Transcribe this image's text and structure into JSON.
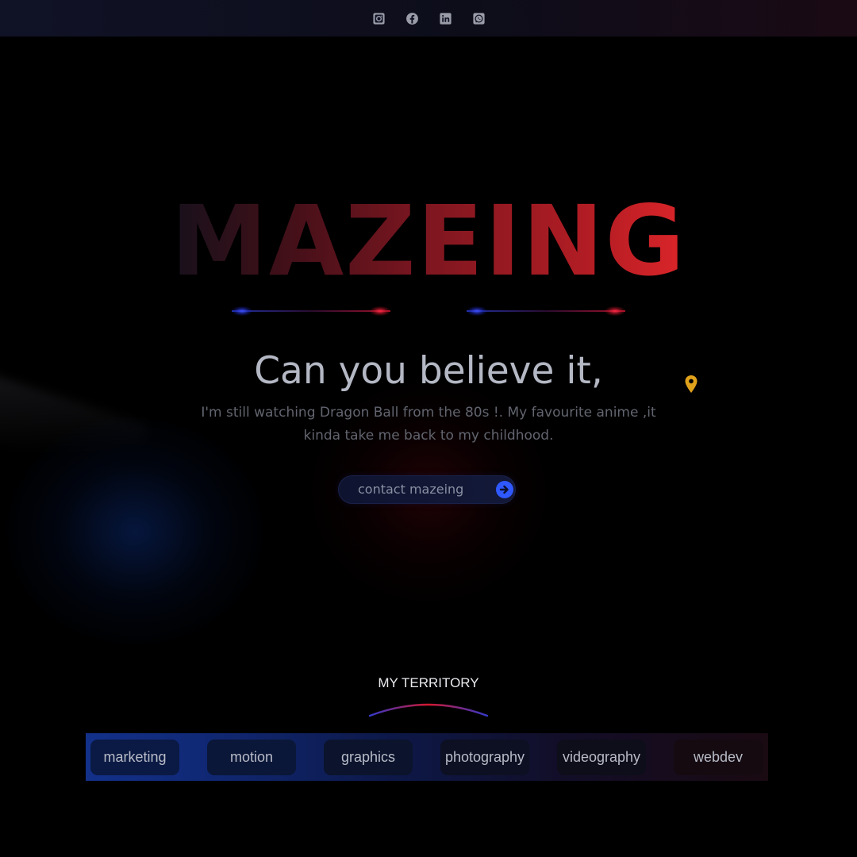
{
  "social": [
    {
      "name": "instagram",
      "icon": "instagram-icon"
    },
    {
      "name": "facebook",
      "icon": "facebook-icon"
    },
    {
      "name": "linkedin",
      "icon": "linkedin-icon"
    },
    {
      "name": "whatsapp",
      "icon": "whatsapp-icon"
    }
  ],
  "hero": {
    "brand": "MAZEING",
    "headline": "Can you believe it,",
    "intro": "I'm still watching Dragon Ball from the 80s !. My favourite anime ,it kinda take me back to my childhood.",
    "cta_label": "contact mazeing",
    "location_icon": "map-pin-icon"
  },
  "territory": {
    "title": "MY TERRITORY",
    "services": [
      "marketing",
      "motion",
      "graphics",
      "photography",
      "videography",
      "webdev"
    ]
  },
  "colors": {
    "brand_red": "#e3272b",
    "accent_blue": "#2f58ff",
    "pin_gold": "#e0a11b",
    "background": "#000000"
  }
}
